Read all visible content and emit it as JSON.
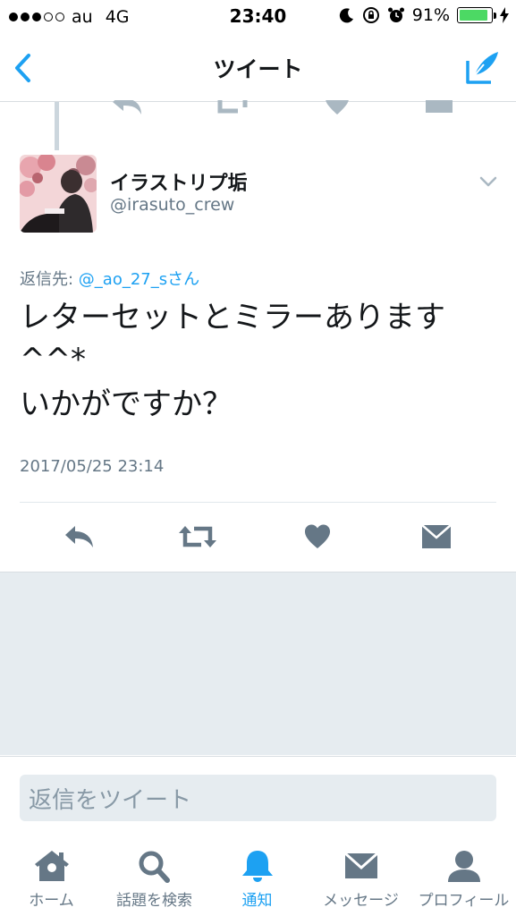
{
  "status_bar": {
    "carrier": "au",
    "network": "4G",
    "time": "23:40",
    "battery": "91%",
    "battery_level": 0.91
  },
  "nav": {
    "title": "ツイート",
    "back_icon": "chevron-left-icon",
    "compose_icon": "compose-tweet-icon"
  },
  "tweet": {
    "user_name": "イラストリプ垢",
    "user_handle": "@irasuto_crew",
    "reply_to_prefix": "返信先: ",
    "reply_to_mention": "@_ao_27_sさん",
    "text_lines": [
      "レターセットとミラーあります",
      "^^*",
      "いかがですか？"
    ],
    "timestamp": "2017/05/25 23:14"
  },
  "actions": [
    {
      "name": "reply-icon"
    },
    {
      "name": "retweet-icon"
    },
    {
      "name": "like-icon"
    },
    {
      "name": "message-icon"
    }
  ],
  "reply_box": {
    "placeholder": "返信をツイート"
  },
  "tabs": [
    {
      "label": "ホーム",
      "icon": "home-icon"
    },
    {
      "label": "話題を検索",
      "icon": "search-icon"
    },
    {
      "label": "通知",
      "icon": "bell-icon",
      "active": true
    },
    {
      "label": "メッセージ",
      "icon": "envelope-icon"
    },
    {
      "label": "プロフィール",
      "icon": "profile-icon"
    }
  ],
  "colors": {
    "accent": "#1da1f2",
    "secondary_text": "#657786",
    "icon_grey": "#657786",
    "background_grey": "#e6ecf0"
  }
}
